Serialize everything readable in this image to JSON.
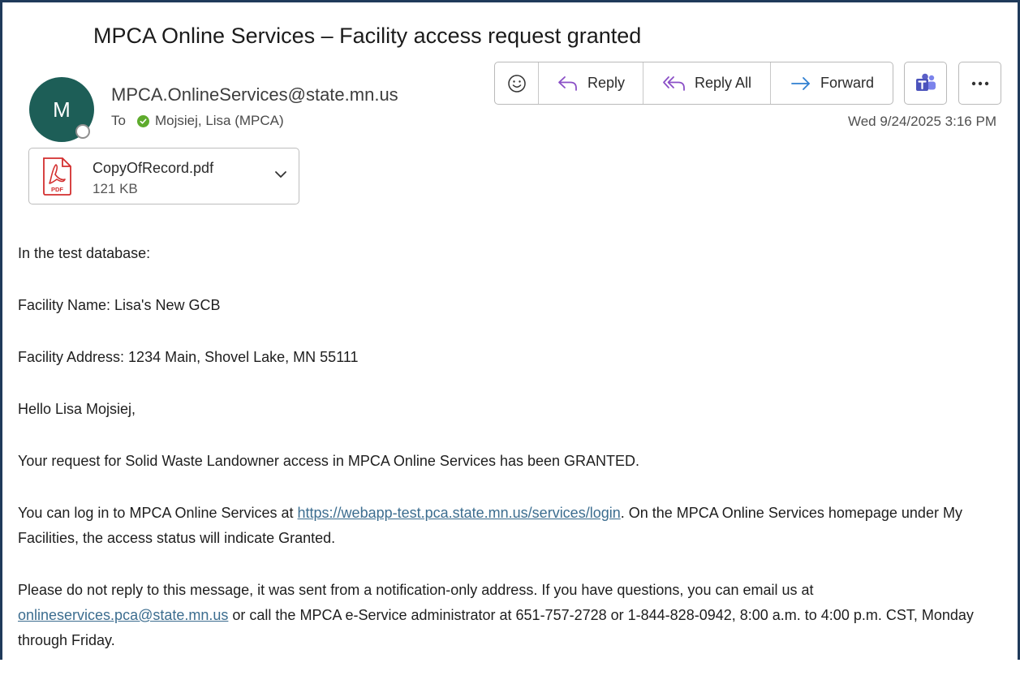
{
  "email": {
    "subject": "MPCA Online Services – Facility access request granted",
    "avatar_initial": "M",
    "sender": "MPCA.OnlineServices@state.mn.us",
    "to_label": "To",
    "recipient": "Mojsiej, Lisa (MPCA)",
    "date": "Wed 9/24/2025 3:16 PM"
  },
  "toolbar": {
    "reply_label": "Reply",
    "reply_all_label": "Reply All",
    "forward_label": "Forward"
  },
  "attachment": {
    "name": "CopyOfRecord.pdf",
    "size": "121 KB",
    "icon_text": "PDF"
  },
  "body": {
    "line1": "In the test database:",
    "line2": "Facility Name: Lisa's New GCB",
    "line3": "Facility Address: 1234 Main, Shovel Lake, MN 55111",
    "line4": "Hello Lisa Mojsiej,",
    "line5": "Your request for Solid Waste Landowner access in MPCA Online Services has been GRANTED.",
    "para6_pre": "You can log in to MPCA Online Services at ",
    "para6_link": "https://webapp-test.pca.state.mn.us/services/login",
    "para6_post": ". On the MPCA Online Services homepage under My Facilities, the access status will indicate Granted.",
    "para7_pre": "Please do not reply to this message, it was sent from a notification-only address. If you have questions, you can email us at ",
    "para7_link": "onlineservices.pca@state.mn.us",
    "para7_post": " or call the MPCA e-Service administrator at 651-757-2728 or 1-844-828-0942, 8:00 a.m. to 4:00 p.m. CST, Monday through Friday."
  },
  "colors": {
    "avatar_bg": "#1d5e57",
    "link": "#3c6d8f",
    "presence_check": "#5eab2d",
    "reply_icon": "#8a4fc6",
    "forward_icon": "#2f7fd1",
    "teams": "#5b5fc7",
    "pdf_red": "#d32f2f"
  }
}
